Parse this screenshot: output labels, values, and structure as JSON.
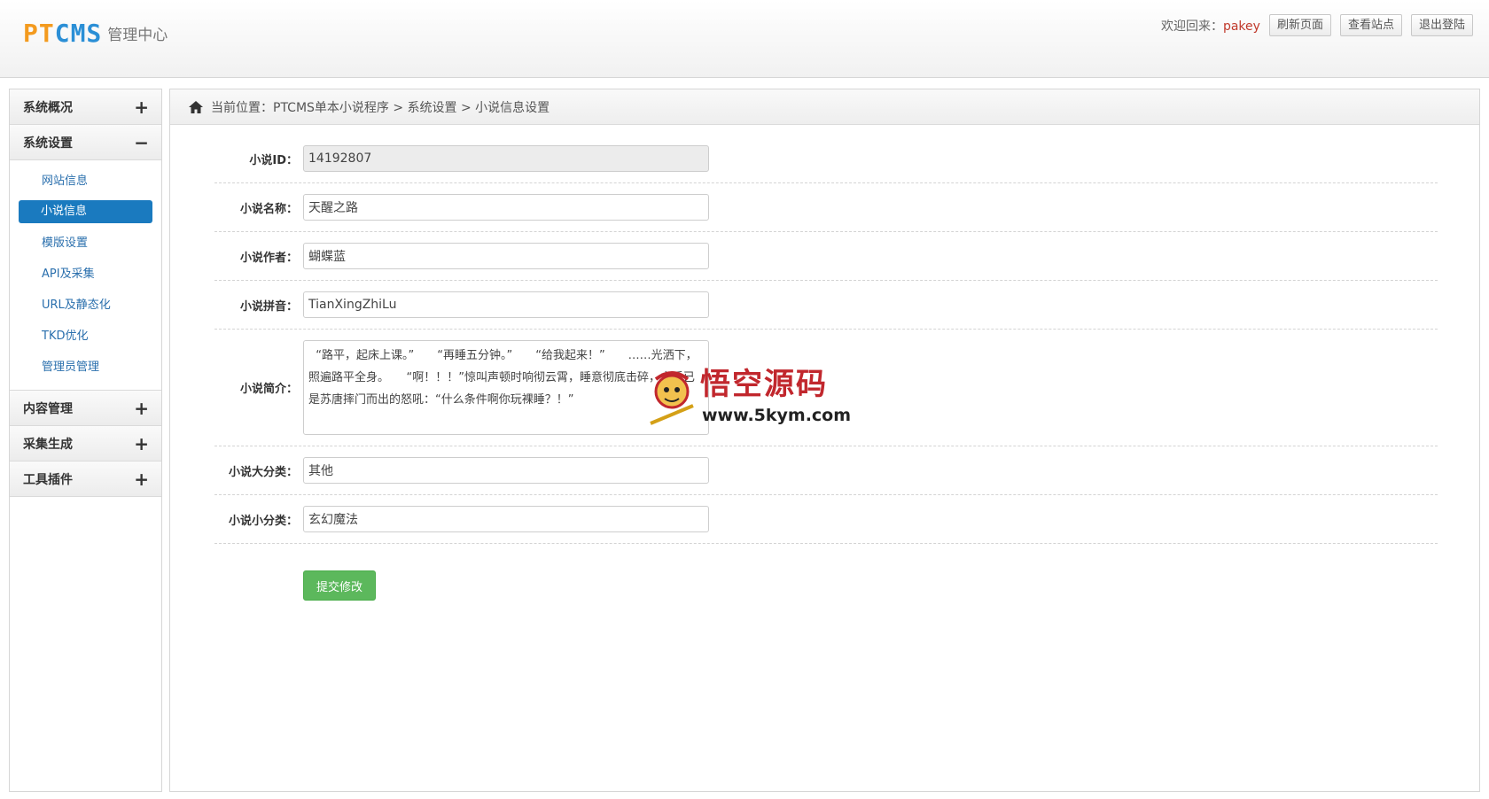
{
  "header": {
    "logo_pt": "PT",
    "logo_cms": "CMS",
    "logo_sub": "管理中心",
    "welcome": "欢迎回来：",
    "username": "pakey",
    "buttons": [
      "刷新页面",
      "查看站点",
      "退出登陆"
    ]
  },
  "sidebar": {
    "groups": [
      {
        "label": "系统概况",
        "toggle": "+"
      },
      {
        "label": "系统设置",
        "toggle": "−"
      },
      {
        "label": "内容管理",
        "toggle": "+"
      },
      {
        "label": "采集生成",
        "toggle": "+"
      },
      {
        "label": "工具插件",
        "toggle": "+"
      }
    ],
    "sub_items": [
      "网站信息",
      "小说信息",
      "模版设置",
      "API及采集",
      "URL及静态化",
      "TKD优化",
      "管理员管理"
    ]
  },
  "breadcrumb": "当前位置：PTCMS单本小说程序 > 系统设置 > 小说信息设置",
  "form": {
    "id_label": "小说ID：",
    "id_value": "14192807",
    "name_label": "小说名称：",
    "name_value": "天醒之路",
    "author_label": "小说作者：",
    "author_value": "蝴蝶蓝",
    "pinyin_label": "小说拼音：",
    "pinyin_value": "TianXingZhiLu",
    "intro_label": "小说简介：",
    "intro_value": "  “路平，起床上课。”　　“再睡五分钟。”　　“给我起来！”　　……光洒下，照遍路平全身。　　“啊！！！”惊叫声顿时响彻云霄，睡意彻底击碎，之后已是苏唐摔门而出的怒吼：“什么条件啊你玩裸睡？！”",
    "cat_label": "小说大分类：",
    "cat_value": "其他",
    "subcat_label": "小说小分类：",
    "subcat_value": "玄幻魔法",
    "submit_label": "提交修改"
  },
  "watermark": {
    "cn": "悟空源码",
    "en": "www.5kym.com"
  },
  "colors": {
    "active_blue": "#1a7abf",
    "link_blue": "#2a6fad",
    "submit_green": "#5cb85c",
    "logo_orange": "#f39a1e",
    "logo_blue": "#2b8fd6"
  }
}
